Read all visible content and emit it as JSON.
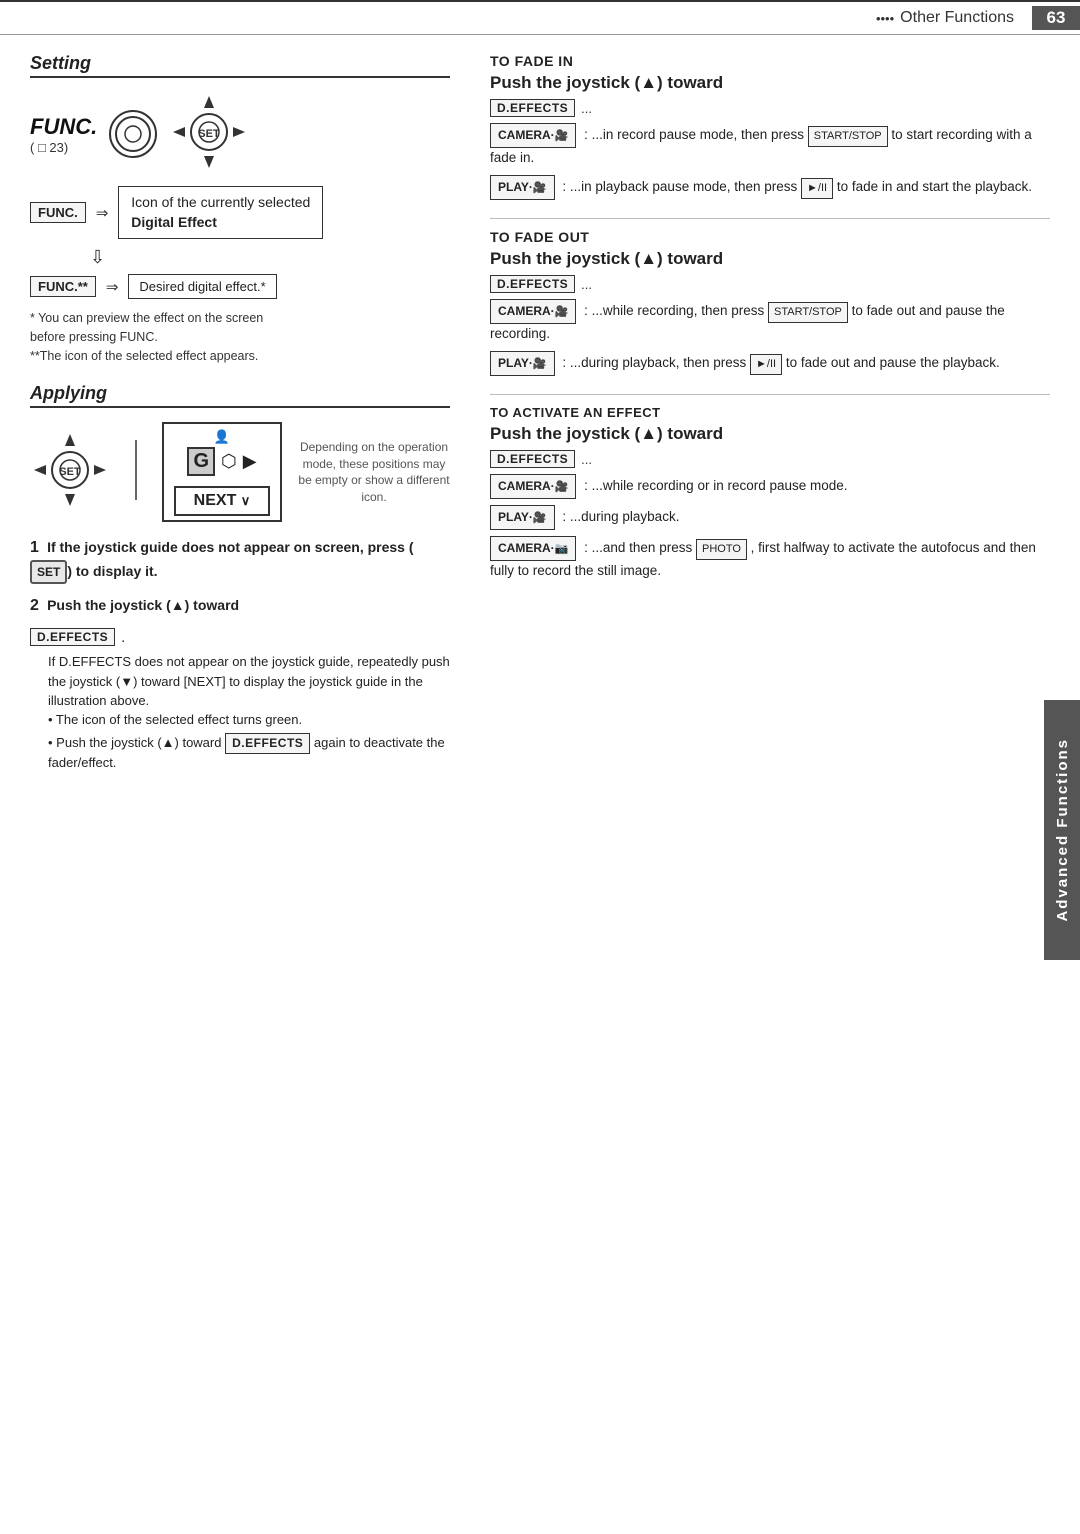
{
  "header": {
    "dots": "••••",
    "title": "Other Functions",
    "page": "63"
  },
  "side_tab": {
    "text": "Advanced Functions"
  },
  "setting": {
    "heading": "Setting",
    "func_label": "FUNC.",
    "func_sub": "( □ 23)",
    "func_sub_page": "23",
    "icon_callout_line1": "Icon of the currently selected",
    "icon_callout_line2": "Digital Effect",
    "func_star": "FUNC.**",
    "desired_text": "Desired digital effect.*",
    "footnote1": "* You can preview the effect on the screen",
    "footnote1b": "before pressing FUNC.",
    "footnote2": "**The icon of the selected effect appears."
  },
  "applying": {
    "heading": "Applying",
    "note": "Depending on the operation\nmode, these positions may be\nempty or show a different icon."
  },
  "steps": {
    "step1_num": "1",
    "step1_text": "If the joystick guide does not appear on screen, press (",
    "step1_set": "SET",
    "step1_text2": ") to display it.",
    "step2_num": "2",
    "step2_text": "Push the joystick (",
    "step2_arrow": "▲",
    "step2_text2": ") toward",
    "d_effects_label": "D.EFFECTS",
    "step2_detail": "If D.EFFECTS does not appear on the joystick guide, repeatedly push the joystick (▼) toward [NEXT] to display the joystick guide in the illustration above.",
    "bullet1": "• The icon of the selected effect turns green.",
    "bullet2": "• Push the joystick (▲) toward",
    "d_effects_again": "D.EFFECTS",
    "bullet2b": " again to deactivate the fader/effect."
  },
  "right": {
    "fade_in_heading": "To Fade In",
    "fade_in_push": "Push the joystick (▲) toward",
    "d_effects_dots": "D.EFFECTS ...",
    "camera_badge1": "CAMERA·🎥",
    "camera_text1": ": ...in record pause mode, then press",
    "start_stop1": "START/STOP",
    "camera_text1b": "to start recording with a fade in.",
    "play_badge1": "PLAY·🎥",
    "play_text1": ": ...in playback pause mode, then press",
    "play_pause1": "►/II",
    "play_text1b": "to fade in and start the playback.",
    "fade_out_heading": "To Fade Out",
    "fade_out_push": "Push the joystick (▲) toward",
    "d_effects_dots2": "D.EFFECTS ...",
    "camera_badge2": "CAMERA·🎥",
    "camera_text2": ": ...while recording, then press",
    "start_stop2": "START/STOP",
    "camera_text2b": "to fade out and pause the recording.",
    "play_badge2": "PLAY·🎥",
    "play_text2": ": ...during playback, then press",
    "play_pause2": "►/II",
    "play_text2b": "to fade out and pause the playback.",
    "activate_heading": "To Activate an Effect",
    "activate_push": "Push the joystick (▲) toward",
    "d_effects_dots3": "D.EFFECTS ...",
    "camera_badge3": "CAMERA·🎥",
    "camera_text3": ": ...while recording or in record pause mode.",
    "play_badge3": "PLAY·🎥",
    "play_text3": ": ...during playback.",
    "camera_badge4": "CAMERA·📷",
    "camera_text4": ": ...and then press",
    "photo_badge": "PHOTO",
    "camera_text4b": ", first halfway to activate the autofocus and then fully to record the still image."
  }
}
